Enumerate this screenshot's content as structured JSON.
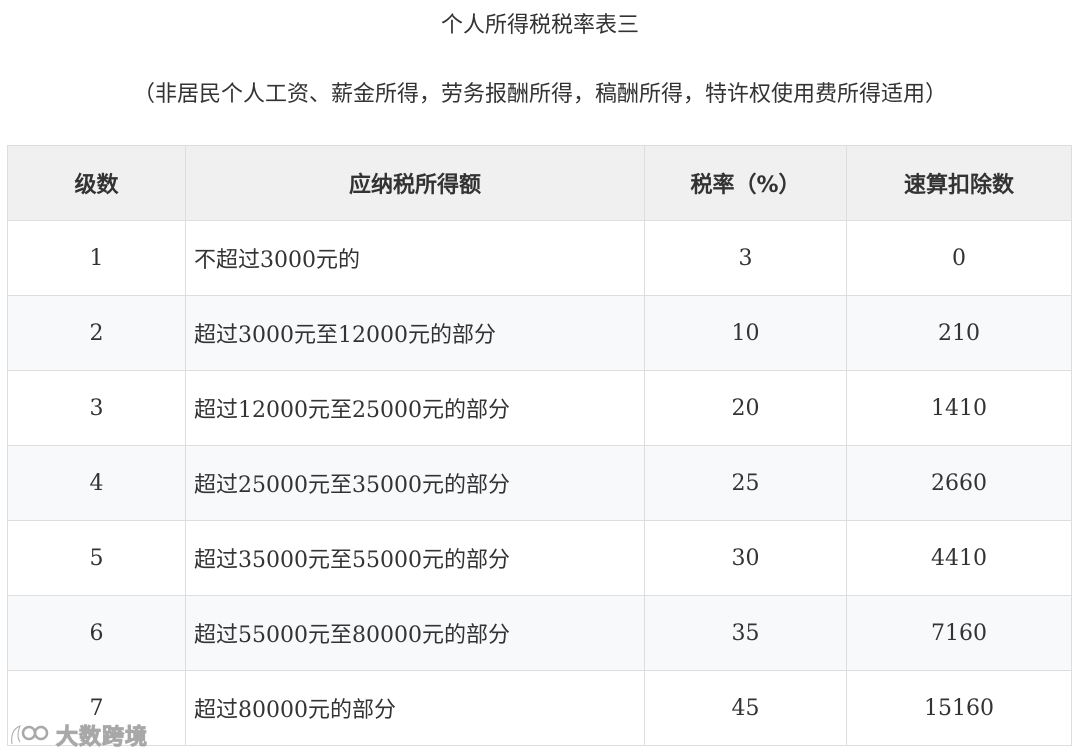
{
  "document": {
    "title": "个人所得税税率表三",
    "subtitle": "（非居民个人工资、薪金所得，劳务报酬所得，稿酬所得，特许权使用费所得适用）"
  },
  "table": {
    "headers": [
      "级数",
      "应纳税所得额",
      "税率（%）",
      "速算扣除数"
    ],
    "rows": [
      {
        "level": "1",
        "range": "不超过3000元的",
        "rate": "3",
        "deduction": "0"
      },
      {
        "level": "2",
        "range": "超过3000元至12000元的部分",
        "rate": "10",
        "deduction": "210"
      },
      {
        "level": "3",
        "range": "超过12000元至25000元的部分",
        "rate": "20",
        "deduction": "1410"
      },
      {
        "level": "4",
        "range": "超过25000元至35000元的部分",
        "rate": "25",
        "deduction": "2660"
      },
      {
        "level": "5",
        "range": "超过35000元至55000元的部分",
        "rate": "30",
        "deduction": "4410"
      },
      {
        "level": "6",
        "range": "超过55000元至80000元的部分",
        "rate": "35",
        "deduction": "7160"
      },
      {
        "level": "7",
        "range": "超过80000元的部分",
        "rate": "45",
        "deduction": "15160"
      }
    ]
  },
  "watermark": {
    "text": "大数跨境",
    "icon": "dashuju-logo-icon"
  },
  "colors": {
    "header_bg": "#f0f0f0",
    "row_alt_bg": "#f8f9fa",
    "border": "#dddddd",
    "text": "#333333"
  }
}
